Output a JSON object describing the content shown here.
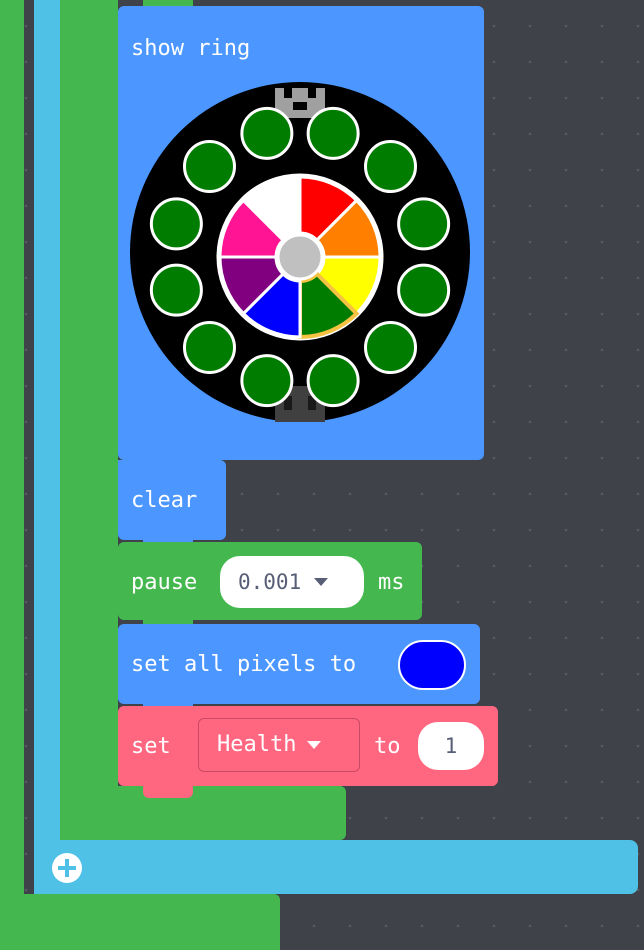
{
  "blocks": {
    "show_ring": {
      "label": "show ring"
    },
    "clear": {
      "label": "clear"
    },
    "pause": {
      "label": "pause",
      "value": "0.001",
      "unit": "ms"
    },
    "set_all_pixels": {
      "label": "set all pixels to",
      "color": "#0000ff"
    },
    "set_variable": {
      "label": "set",
      "variable": "Health",
      "to_label": "to",
      "value": "1"
    }
  },
  "ring": {
    "outer_leds": [
      "#007c00",
      "#007c00",
      "#007c00",
      "#007c00",
      "#007c00",
      "#007c00",
      "#007c00",
      "#007c00",
      "#007c00",
      "#007c00",
      "#007c00",
      "#007c00"
    ],
    "segments": [
      "#ff0000",
      "#ff8000",
      "#ffff00",
      "#007c00",
      "#0000ff",
      "#800080",
      "#ff1493",
      "#ffffff"
    ],
    "selected_segment": 3
  },
  "colors": {
    "loop_outer": "#45b74f",
    "loop_light": "#4fc0e6",
    "loop_inner": "#45b74f",
    "block_blue": "#4c97ff",
    "block_green": "#45b74f",
    "block_red": "#ff6680"
  },
  "icons": {
    "add": "plus-circle-icon",
    "dropdown": "caret-down-icon"
  }
}
